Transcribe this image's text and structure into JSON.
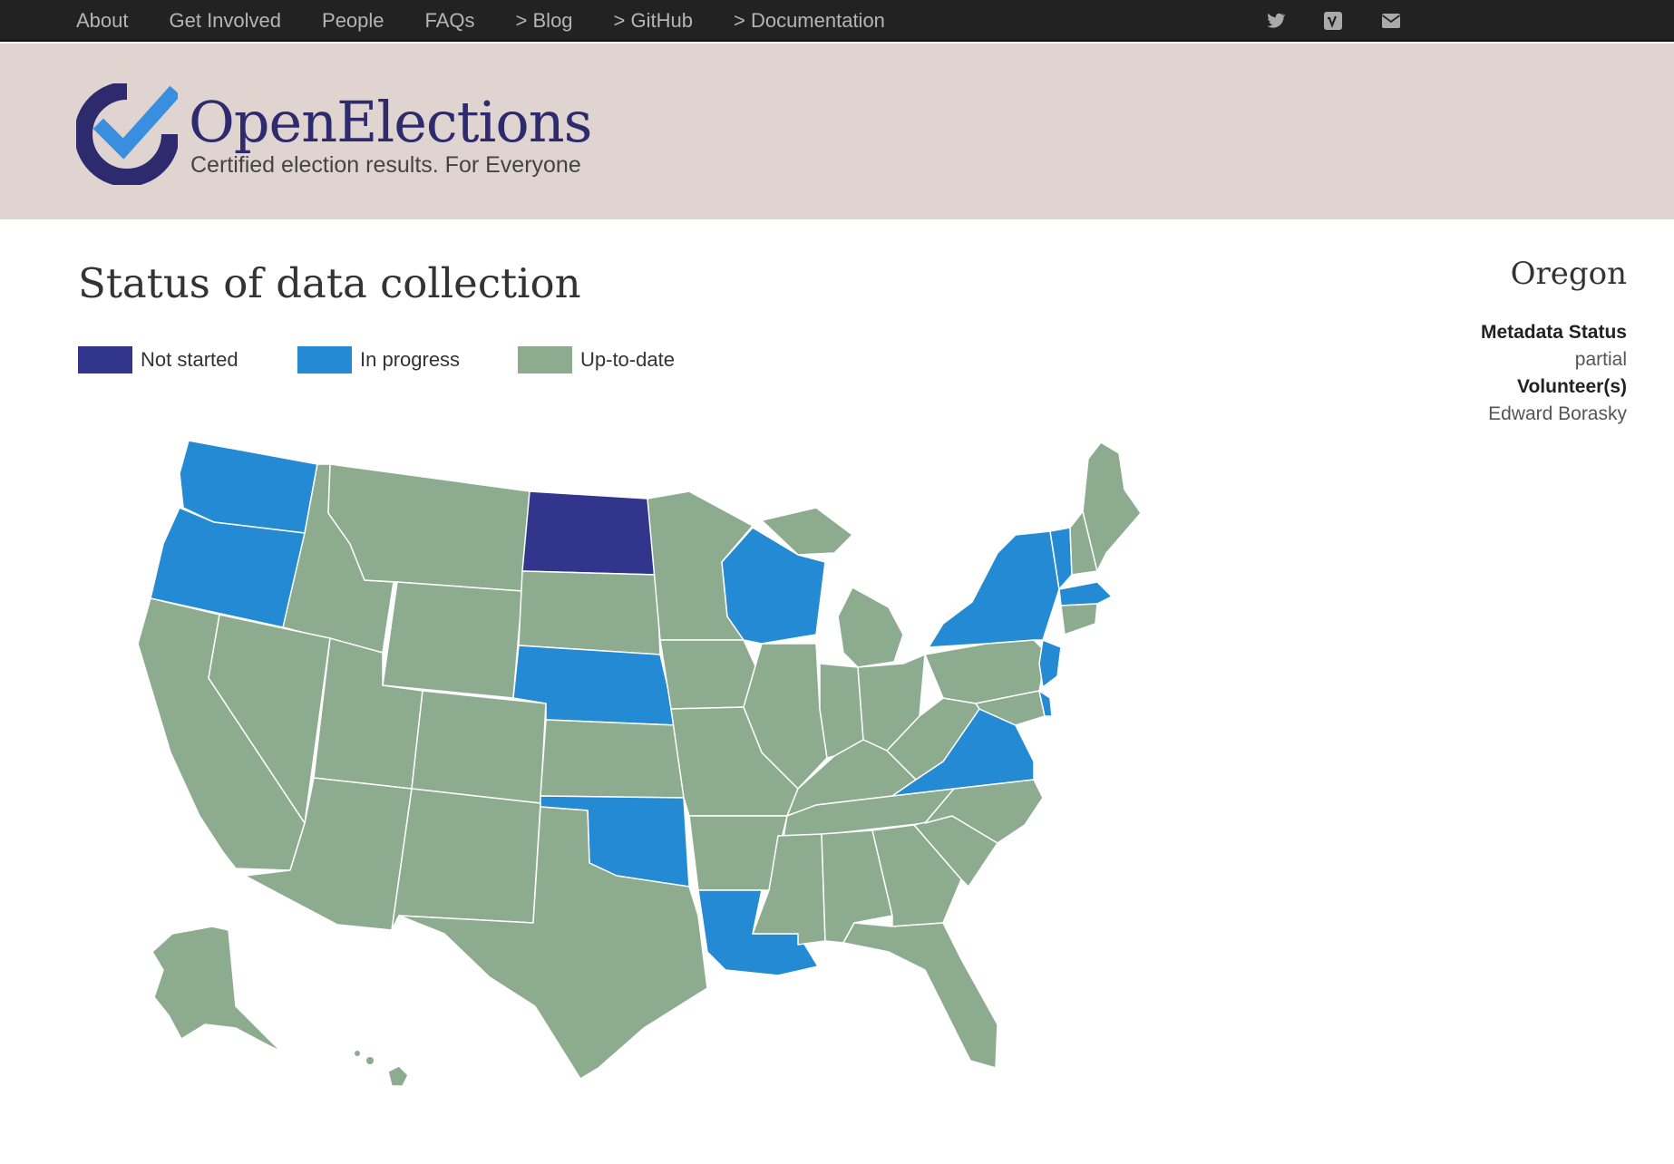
{
  "nav": {
    "items": [
      {
        "label": "About"
      },
      {
        "label": "Get Involved"
      },
      {
        "label": "People"
      },
      {
        "label": "FAQs"
      },
      {
        "label": "> Blog"
      },
      {
        "label": "> GitHub"
      },
      {
        "label": "> Documentation"
      }
    ],
    "icons": [
      "twitter-icon",
      "vimeo-icon",
      "email-icon"
    ]
  },
  "brand": {
    "name": "OpenElections",
    "tagline": "Certified election results. For Everyone"
  },
  "main": {
    "title": "Status of data collection"
  },
  "legend": [
    {
      "label": "Not started",
      "color": "#32358c"
    },
    {
      "label": "In progress",
      "color": "#258ad4"
    },
    {
      "label": "Up-to-date",
      "color": "#8dab8e"
    }
  ],
  "colors": {
    "not_started": "#32358c",
    "in_progress": "#258ad4",
    "up_to_date": "#8dab8e",
    "nav_bg": "#222222",
    "banner_bg": "#e0d4d0"
  },
  "map": {
    "in_progress_states": [
      "Washington",
      "Oregon",
      "Nebraska",
      "Oklahoma",
      "Louisiana",
      "Wisconsin",
      "New York",
      "Vermont",
      "Massachusetts",
      "Virginia",
      "Delaware",
      "New Jersey"
    ],
    "not_started_states": [
      "North Dakota"
    ]
  },
  "detail": {
    "state": "Oregon",
    "metadata_label": "Metadata Status",
    "metadata_value": "partial",
    "volunteer_label": "Volunteer(s)",
    "volunteer_value": "Edward Borasky"
  }
}
